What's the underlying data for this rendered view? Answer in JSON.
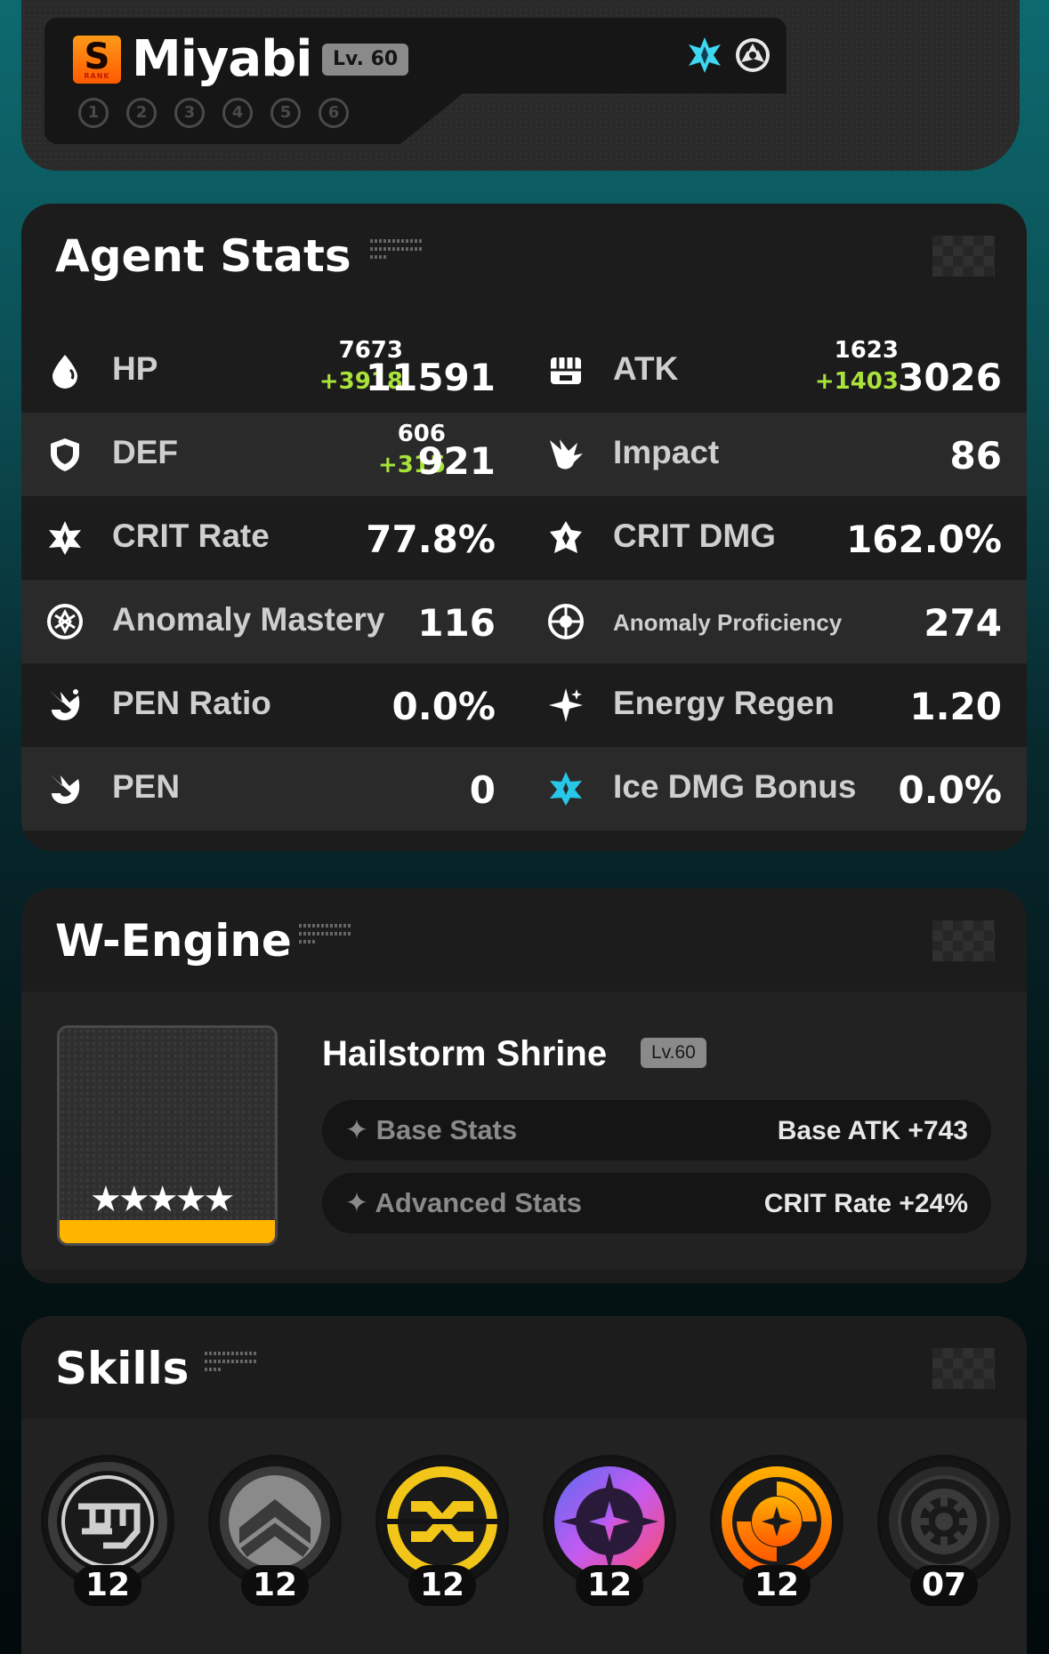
{
  "agent": {
    "rank_letter": "S",
    "rank_word": "RANK",
    "name": "Miyabi",
    "level": "Lv. 60",
    "constellations": [
      "1",
      "2",
      "3",
      "4",
      "5",
      "6"
    ],
    "attribute_icons": [
      "ice-attribute-icon",
      "anomaly-specialty-icon"
    ]
  },
  "agent_stats": {
    "title": "Agent Stats",
    "rows": [
      {
        "left": {
          "name": "HP",
          "base": "7673",
          "bonus": "+3918",
          "total": "11591",
          "icon": "hp-drop-icon"
        },
        "right": {
          "name": "ATK",
          "base": "1623",
          "bonus": "+1403",
          "total": "3026",
          "icon": "atk-fist-icon"
        }
      },
      {
        "left": {
          "name": "DEF",
          "base": "606",
          "bonus": "+315",
          "total": "921",
          "icon": "def-shield-icon"
        },
        "right": {
          "name": "Impact",
          "total": "86",
          "icon": "impact-icon"
        }
      },
      {
        "left": {
          "name": "CRIT Rate",
          "total": "77.8%",
          "icon": "crit-rate-icon"
        },
        "right": {
          "name": "CRIT DMG",
          "total": "162.0%",
          "icon": "crit-dmg-icon"
        }
      },
      {
        "left": {
          "name": "Anomaly Mastery",
          "total": "116",
          "icon": "anomaly-mastery-icon"
        },
        "right": {
          "name": "Anomaly Proficiency",
          "total": "274",
          "icon": "anomaly-proficiency-icon"
        }
      },
      {
        "left": {
          "name": "PEN Ratio",
          "total": "0.0%",
          "icon": "pen-ratio-icon"
        },
        "right": {
          "name": "Energy Regen",
          "total": "1.20",
          "icon": "energy-regen-icon"
        }
      },
      {
        "left": {
          "name": "PEN",
          "total": "0",
          "icon": "pen-icon"
        },
        "right": {
          "name": "Ice DMG Bonus",
          "total": "0.0%",
          "icon": "ice-dmg-icon"
        }
      }
    ]
  },
  "w_engine": {
    "title": "W-Engine",
    "name": "Hailstorm Shrine",
    "level": "Lv.60",
    "stars": "★★★★★",
    "base_stats_label": "Base Stats",
    "base_stats_value": "Base ATK +743",
    "advanced_stats_label": "Advanced Stats",
    "advanced_stats_value": "CRIT Rate +24%"
  },
  "skills": {
    "title": "Skills",
    "items": [
      {
        "icon": "basic-attack-icon",
        "level": "12",
        "color": "#cfcfcf"
      },
      {
        "icon": "dodge-icon",
        "level": "12",
        "color": "#9a9a9a"
      },
      {
        "icon": "assist-icon",
        "level": "12",
        "color": "#f2c619"
      },
      {
        "icon": "special-attack-icon",
        "level": "12",
        "color": "#c45af0"
      },
      {
        "icon": "chain-attack-icon",
        "level": "12",
        "color": "#ff8a00"
      },
      {
        "icon": "core-skill-icon",
        "level": "07",
        "color": "#3a3a3a"
      }
    ]
  },
  "colors": {
    "bonus_green": "#a8e23a",
    "rank_orange": "#ff7a00",
    "engine_bar": "#ffb400",
    "ice_cyan": "#27c7e8"
  }
}
